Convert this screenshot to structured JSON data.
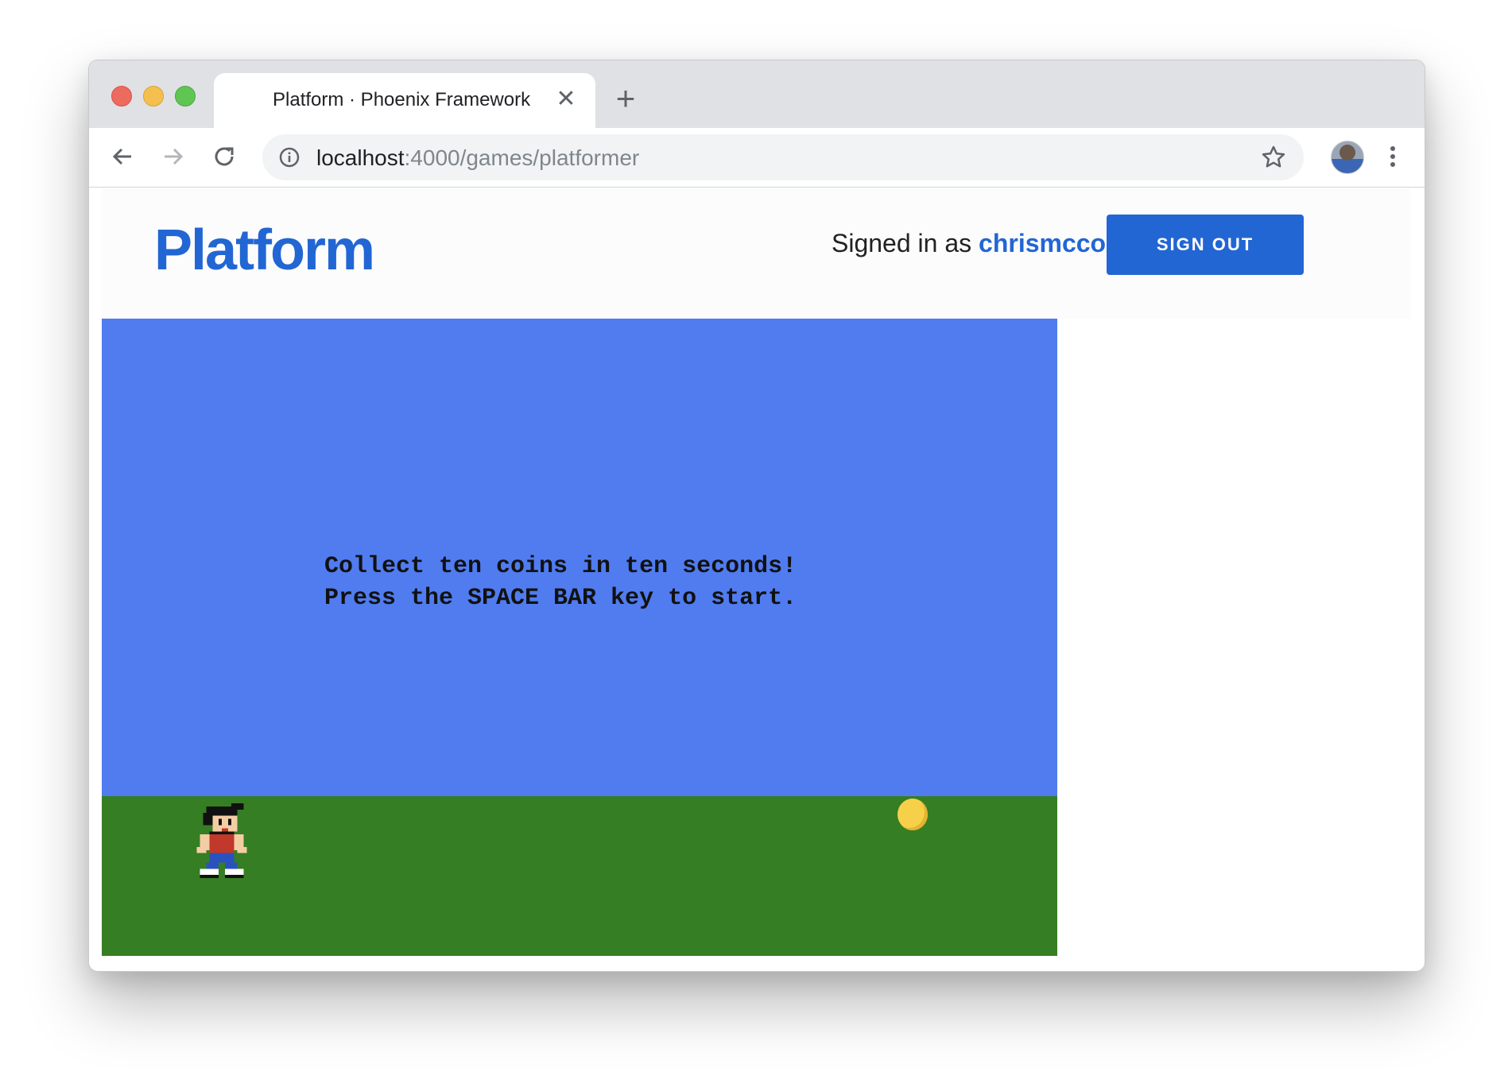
{
  "browser": {
    "tab_title": "Platform · Phoenix Framework",
    "close_glyph": "✕",
    "new_tab_glyph": "+",
    "url_host": "localhost",
    "url_rest": ":4000/games/platformer"
  },
  "header": {
    "brand": "Platform",
    "signed_in_prefix": "Signed in as ",
    "username": "chrismccord",
    "sign_out_label": "SIGN OUT"
  },
  "game": {
    "message_line1": "Collect ten coins in ten seconds!",
    "message_line2": "Press the SPACE BAR key to start."
  },
  "colors": {
    "brand_blue": "#2266d4",
    "sky": "#507cf0",
    "grass": "#367e23",
    "coin": "#f7d04a"
  },
  "icons": [
    "back-arrow-icon",
    "forward-arrow-icon",
    "reload-icon",
    "info-icon",
    "star-icon",
    "menu-dots-icon",
    "close-icon",
    "plus-icon"
  ]
}
